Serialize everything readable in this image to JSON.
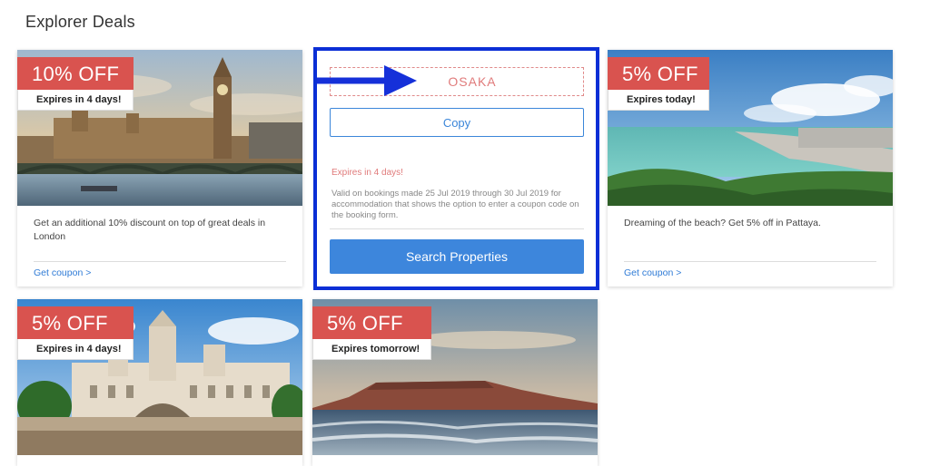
{
  "page": {
    "title": "Explorer Deals"
  },
  "colors": {
    "accent_red": "#d9534f",
    "link_blue": "#2f7bd6",
    "button_blue": "#3d86dc",
    "highlight_border": "#0b2fd6"
  },
  "deals": [
    {
      "discount": "10% OFF",
      "expiry": "Expires in 4 days!",
      "description": "Get an additional 10% discount on top of great deals in London",
      "link": "Get coupon >"
    },
    {
      "discount": "5% OFF",
      "expiry": "Expires today!",
      "description": "Dreaming of the beach? Get 5% off in Pattaya.",
      "link": "Get coupon >"
    },
    {
      "discount": "5% OFF",
      "expiry": "Expires in 4 days!"
    },
    {
      "discount": "5% OFF",
      "expiry": "Expires tomorrow!"
    }
  ],
  "coupon_panel": {
    "code": "OSAKA",
    "copy_label": "Copy",
    "expiry": "Expires in 4 days!",
    "terms": "Valid on bookings made 25 Jul 2019 through 30 Jul 2019 for accommodation that shows the option to enter a coupon code on the booking form.",
    "search_label": "Search Properties"
  },
  "annotation": {
    "icon": "arrow-right-icon",
    "color": "#1530d9"
  }
}
